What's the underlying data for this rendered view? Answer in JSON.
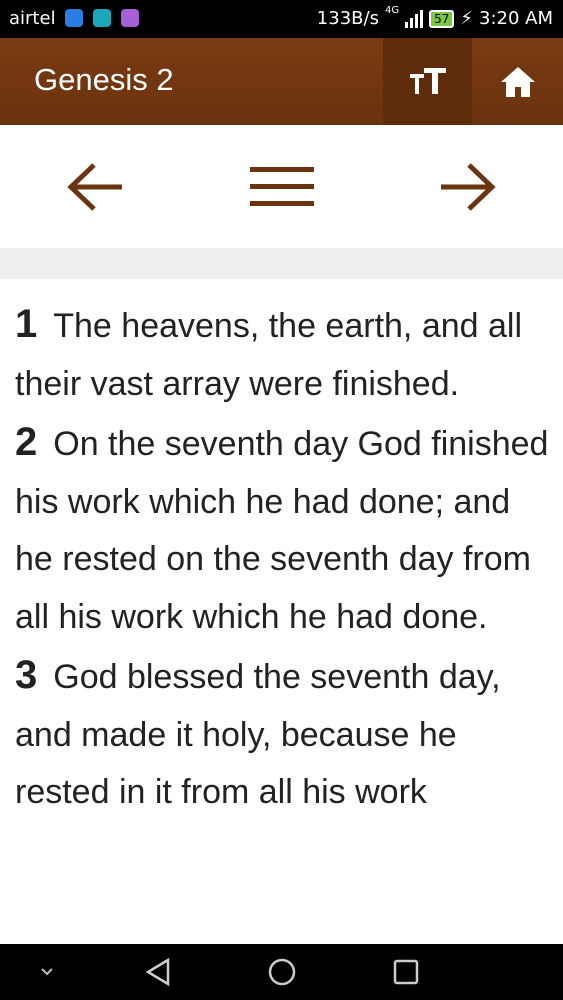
{
  "status_bar": {
    "carrier": "airtel",
    "network_speed": "133B/s",
    "network_type": "4G",
    "battery": "57",
    "time": "3:20 AM"
  },
  "app_bar": {
    "title": "Genesis 2",
    "font_size_icon": "text-size-icon",
    "home_icon": "home-icon",
    "color": "#6f360f"
  },
  "navigation": {
    "prev_icon": "arrow-left-icon",
    "menu_icon": "menu-icon",
    "next_icon": "arrow-right-icon",
    "icon_color": "#6b3310"
  },
  "verses": [
    {
      "number": "1",
      "text": "The heavens, the earth, and all their vast array were finished."
    },
    {
      "number": "2",
      "text": "On the seventh day God finished his work which he had done; and he rested on the seventh day from all his work which he had done."
    },
    {
      "number": "3",
      "text": "God blessed the seventh day, and made it holy, because he rested in it from all his work"
    }
  ],
  "system_nav": {
    "collapse_icon": "chevron-down-icon",
    "back_icon": "back-triangle-icon",
    "home_icon": "home-circle-icon",
    "recents_icon": "recents-square-icon"
  }
}
